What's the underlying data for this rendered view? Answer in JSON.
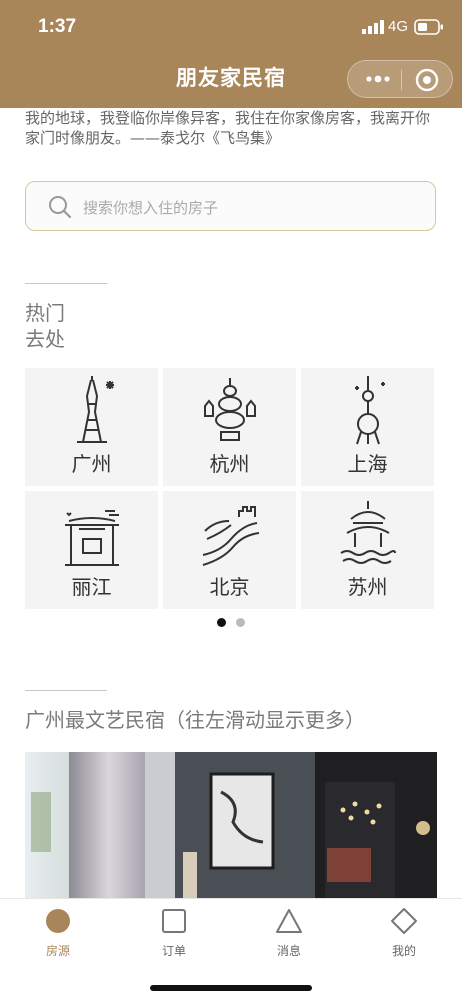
{
  "status_bar": {
    "time": "1:37",
    "network": "4G"
  },
  "nav": {
    "title": "朋友家民宿"
  },
  "quote": "我的地球，我登临你岸像异客，我住在你家像房客，我离开你家门时像朋友。——泰戈尔《飞鸟集》",
  "search": {
    "placeholder": "搜索你想入住的房子"
  },
  "hot": {
    "title_line1": "热门",
    "title_line2": "去处",
    "cities": [
      {
        "name": "广州",
        "icon": "canton-tower-icon"
      },
      {
        "name": "杭州",
        "icon": "pagoda-icon"
      },
      {
        "name": "上海",
        "icon": "oriental-pearl-tower-icon"
      },
      {
        "name": "丽江",
        "icon": "old-town-gate-icon"
      },
      {
        "name": "北京",
        "icon": "great-wall-icon"
      },
      {
        "name": "苏州",
        "icon": "pavilion-icon"
      }
    ],
    "pagination": {
      "current": 1,
      "total": 2
    }
  },
  "featured": {
    "title": "广州最文艺民宿（往左滑动显示更多）"
  },
  "tabbar": {
    "items": [
      {
        "label": "房源",
        "icon": "circle-icon",
        "active": true
      },
      {
        "label": "订单",
        "icon": "square-icon",
        "active": false
      },
      {
        "label": "消息",
        "icon": "triangle-icon",
        "active": false
      },
      {
        "label": "我的",
        "icon": "diamond-icon",
        "active": false
      }
    ]
  },
  "colors": {
    "brand": "#a9865a",
    "accent_border": "#d9c69d",
    "cell_bg": "#f4f4f4"
  }
}
